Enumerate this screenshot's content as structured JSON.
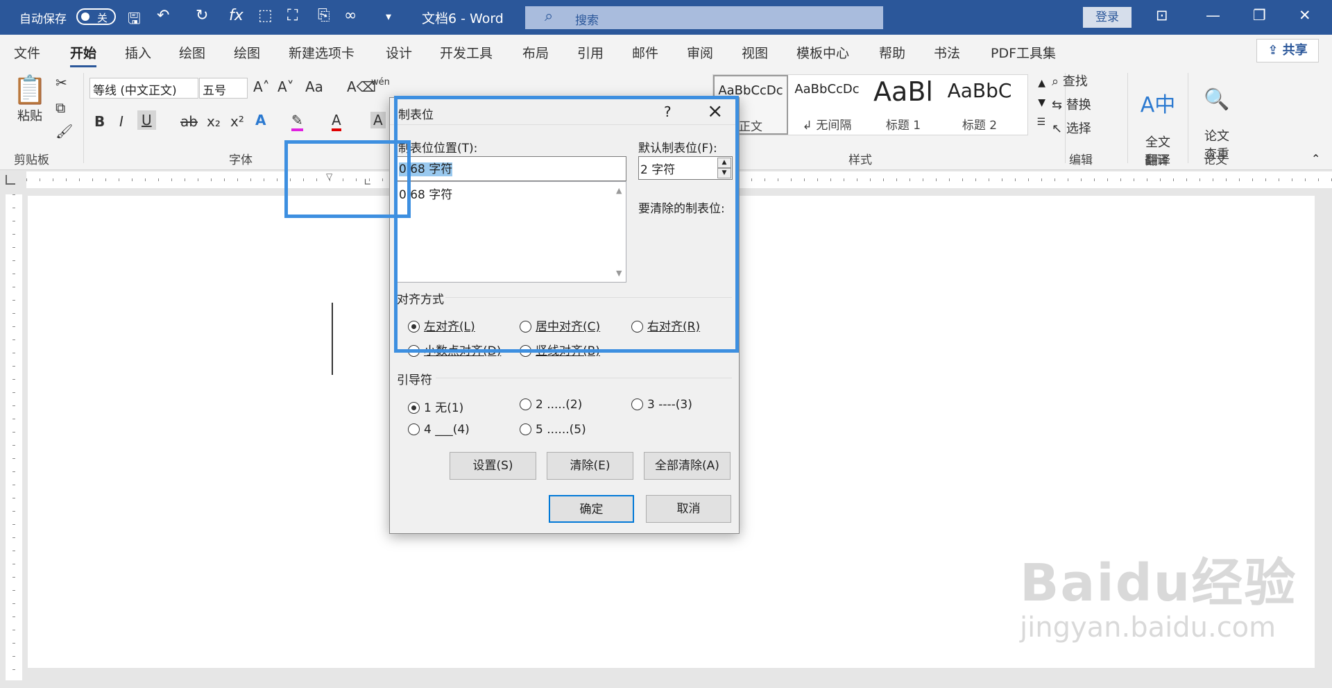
{
  "titlebar": {
    "autosave_label": "自动保存",
    "autosave_state": "关",
    "doc_title": "文档6  -  Word",
    "search_placeholder": "搜索",
    "login": "登录"
  },
  "tabs": [
    "文件",
    "开始",
    "插入",
    "绘图",
    "绘图",
    "新建选项卡",
    "设计",
    "开发工具",
    "布局",
    "引用",
    "邮件",
    "审阅",
    "视图",
    "模板中心",
    "帮助",
    "书法",
    "PDF工具集"
  ],
  "active_tab": "开始",
  "share": "共享",
  "ribbon": {
    "paste": "粘贴",
    "clipboard_group": "剪贴板",
    "font_name": "等线 (中文正文)",
    "font_size": "五号",
    "font_group": "字体",
    "styles_group": "样式",
    "styles": [
      {
        "sample": "AaBbCcDc",
        "name": "正文"
      },
      {
        "sample": "AaBbCcDc",
        "name": "↲ 无间隔"
      },
      {
        "sample": "AaBl",
        "name": "标题 1"
      },
      {
        "sample": "AaBbC",
        "name": "标题 2"
      }
    ],
    "edit_items": [
      "查找",
      "替换",
      "选择"
    ],
    "edit_group": "编辑",
    "translate_btn": "全文\n翻译",
    "translate_group": "翻译",
    "paper_btn": "论文\n查重",
    "paper_group": "论文"
  },
  "dialog": {
    "title": "制表位",
    "help": "?",
    "tab_pos_label": "制表位位置(T):",
    "tab_pos_value": "0.68 字符",
    "list_items": [
      "0.68 字符"
    ],
    "default_tab_label": "默认制表位(F):",
    "default_tab_value": "2 字符",
    "clear_label": "要清除的制表位:",
    "align_section": "对齐方式",
    "align_options": [
      "左对齐(L)",
      "居中对齐(C)",
      "右对齐(R)",
      "小数点对齐(D)",
      "竖线对齐(B)"
    ],
    "align_selected": "左对齐(L)",
    "leader_section": "引导符",
    "leader_options": [
      "1 无(1)",
      "2 .....(2)",
      "3 ----(3)",
      "4 ___(4)",
      "5 ......(5)"
    ],
    "leader_selected": "1 无(1)",
    "btn_set": "设置(S)",
    "btn_clear": "清除(E)",
    "btn_clear_all": "全部清除(A)",
    "btn_ok": "确定",
    "btn_cancel": "取消"
  },
  "watermark": {
    "line1": "Baidu经验",
    "line2": "jingyan.baidu.com"
  },
  "colors": {
    "title_bar": "#2b579a",
    "highlight_box": "#3d8fe0"
  }
}
